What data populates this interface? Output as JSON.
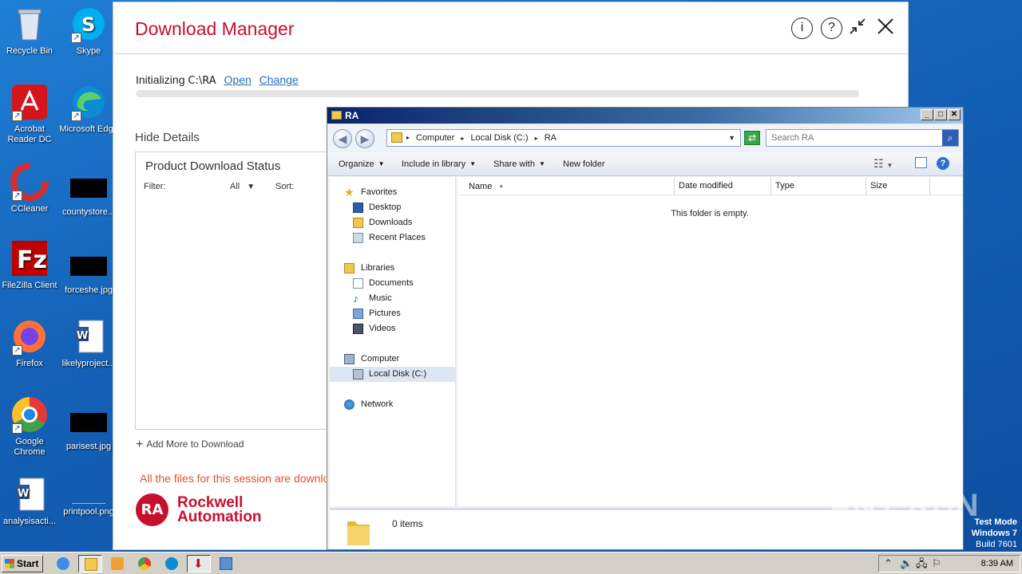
{
  "desktop": {
    "icons": [
      {
        "label": "Recycle Bin"
      },
      {
        "label": "Skype"
      },
      {
        "label": "Acrobat Reader DC"
      },
      {
        "label": "Microsoft Edge"
      },
      {
        "label": "CCleaner"
      },
      {
        "label": "countystore..."
      },
      {
        "label": "FileZilla Client"
      },
      {
        "label": "forceshe.jpg"
      },
      {
        "label": "Firefox"
      },
      {
        "label": "likelyproject..."
      },
      {
        "label": "Google Chrome"
      },
      {
        "label": "parisest.jpg"
      },
      {
        "label": "analysisacti..."
      },
      {
        "label": "printpool.png"
      }
    ]
  },
  "download_manager": {
    "title": "Download Manager",
    "info_icon": "i",
    "help_icon": "?",
    "initializing_label": "Initializing",
    "path": "C:\\RA",
    "open_link": "Open",
    "change_link": "Change",
    "hide_details": "Hide Details",
    "status_title": "Product Download Status",
    "filter_label": "Filter:",
    "filter_value": "All",
    "sort_label": "Sort:",
    "add_more": "Add More to Download",
    "session_message": "All the files for this session are downlo",
    "logo_mark": "RA",
    "logo_line1": "Rockwell",
    "logo_line2": "Automation"
  },
  "explorer": {
    "title": "RA",
    "address": {
      "computer": "Computer",
      "disk": "Local Disk (C:)",
      "folder": "RA"
    },
    "search_placeholder": "Search RA",
    "toolbar": {
      "organize": "Organize",
      "include_in_library": "Include in library",
      "share_with": "Share with",
      "new_folder": "New folder"
    },
    "nav": {
      "favorites": "Favorites",
      "desktop": "Desktop",
      "downloads": "Downloads",
      "recent_places": "Recent Places",
      "libraries": "Libraries",
      "documents": "Documents",
      "music": "Music",
      "pictures": "Pictures",
      "videos": "Videos",
      "computer": "Computer",
      "local_disk": "Local Disk (C:)",
      "network": "Network"
    },
    "columns": {
      "name": "Name",
      "date_modified": "Date modified",
      "type": "Type",
      "size": "Size"
    },
    "empty_message": "This folder is empty.",
    "items_count": "0 items"
  },
  "watermark": "ANY RUN",
  "test_mode": {
    "line1": "Test Mode",
    "line2": "Windows 7",
    "line3": "Build 7601"
  },
  "taskbar": {
    "start": "Start",
    "clock": "8:39 AM"
  }
}
